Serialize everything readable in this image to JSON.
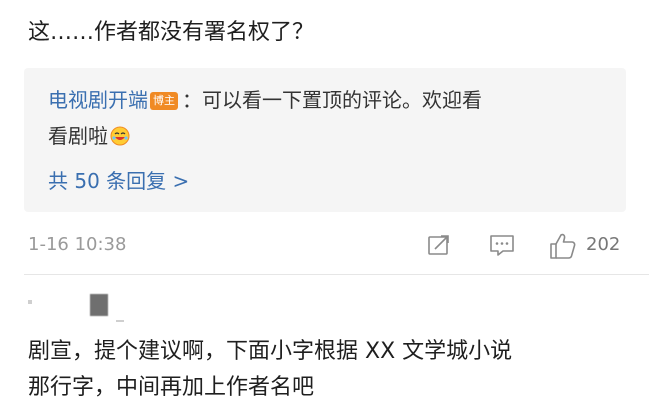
{
  "comment": {
    "text": "这……作者都没有署名权了？"
  },
  "reply": {
    "author": "电视剧开端",
    "badge": "博主",
    "text_part1": "：可以看一下置顶的评论。欢迎看",
    "text_part2": "看剧啦",
    "emoji": "laughing-face",
    "more_replies_label": "共 50 条回复 >"
  },
  "meta": {
    "timestamp": "1-16 10:38",
    "like_count": "202"
  },
  "second_comment": {
    "text_line1": "剧宣，提个建议啊，下面小字根据 XX 文学城小说",
    "text_line2": "那行字，中间再加上作者名吧"
  },
  "colors": {
    "link": "#3a6fb0",
    "badge": "#f08a24",
    "reply_bg": "#f5f5f5"
  }
}
